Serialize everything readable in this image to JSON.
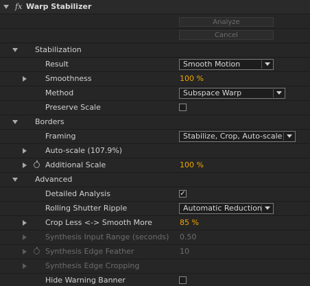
{
  "effect": {
    "fx_label": "fx",
    "name": "Warp Stabilizer"
  },
  "buttons": {
    "analyze": "Analyze",
    "cancel": "Cancel"
  },
  "stabilization": {
    "label": "Stabilization",
    "result_label": "Result",
    "result_value": "Smooth Motion",
    "smoothness_label": "Smoothness",
    "smoothness_value": "100 %",
    "method_label": "Method",
    "method_value": "Subspace Warp",
    "preserve_scale_label": "Preserve Scale",
    "preserve_scale_checked": false
  },
  "borders": {
    "label": "Borders",
    "framing_label": "Framing",
    "framing_value": "Stabilize, Crop, Auto-scale",
    "auto_scale_label": "Auto-scale (107.9%)",
    "additional_scale_label": "Additional Scale",
    "additional_scale_value": "100 %"
  },
  "advanced": {
    "label": "Advanced",
    "detailed_analysis_label": "Detailed Analysis",
    "detailed_analysis_checked": true,
    "check_glyph": "✓",
    "rolling_shutter_label": "Rolling Shutter Ripple",
    "rolling_shutter_value": "Automatic Reduction",
    "crop_smooth_label": "Crop Less <-> Smooth More",
    "crop_smooth_value": "85 %",
    "synth_input_label": "Synthesis Input Range (seconds)",
    "synth_input_value": "0.50",
    "synth_feather_label": "Synthesis Edge Feather",
    "synth_feather_value": "10",
    "synth_cropping_label": "Synthesis Edge Cropping",
    "hide_warning_label": "Hide Warning Banner",
    "hide_warning_checked": false
  },
  "colors": {
    "value_orange": "#f0a800",
    "disabled_text": "#6d6d6d",
    "background": "#232323"
  }
}
